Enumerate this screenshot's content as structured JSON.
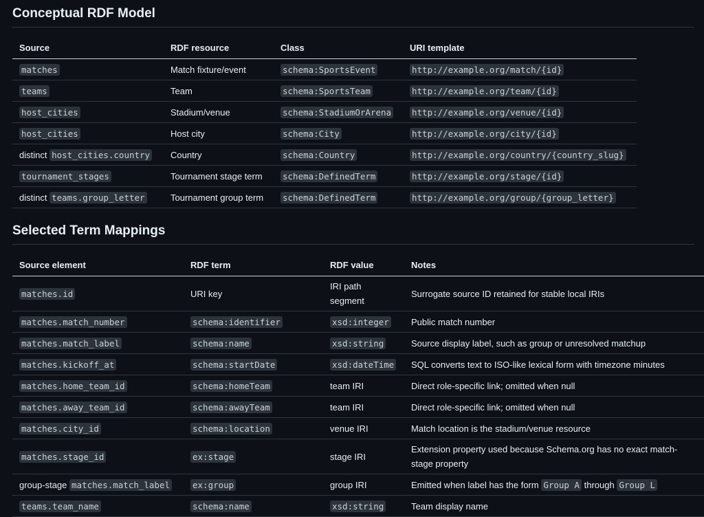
{
  "section1": {
    "title": "Conceptual RDF Model",
    "headers": [
      "Source",
      "RDF resource",
      "Class",
      "URI template"
    ],
    "rows": [
      {
        "source_prefix": "",
        "source_code": "matches",
        "resource": "Match fixture/event",
        "class": "schema:SportsEvent",
        "uri": "http://example.org/match/{id}"
      },
      {
        "source_prefix": "",
        "source_code": "teams",
        "resource": "Team",
        "class": "schema:SportsTeam",
        "uri": "http://example.org/team/{id}"
      },
      {
        "source_prefix": "",
        "source_code": "host_cities",
        "resource": "Stadium/venue",
        "class": "schema:StadiumOrArena",
        "uri": "http://example.org/venue/{id}"
      },
      {
        "source_prefix": "",
        "source_code": "host_cities",
        "resource": "Host city",
        "class": "schema:City",
        "uri": "http://example.org/city/{id}"
      },
      {
        "source_prefix": "distinct",
        "source_code": "host_cities.country",
        "resource": "Country",
        "class": "schema:Country",
        "uri": "http://example.org/country/{country_slug}"
      },
      {
        "source_prefix": "",
        "source_code": "tournament_stages",
        "resource": "Tournament stage term",
        "class": "schema:DefinedTerm",
        "uri": "http://example.org/stage/{id}"
      },
      {
        "source_prefix": "distinct",
        "source_code": "teams.group_letter",
        "resource": "Tournament group term",
        "class": "schema:DefinedTerm",
        "uri": "http://example.org/group/{group_letter}"
      }
    ]
  },
  "section2": {
    "title": "Selected Term Mappings",
    "headers": [
      "Source element",
      "RDF term",
      "RDF value",
      "Notes"
    ],
    "rows": [
      {
        "el_prefix": "",
        "el_code": "matches.id",
        "term": "URI key",
        "term_code": false,
        "value": "IRI path segment",
        "value_code": false,
        "note_parts": [
          "Surrogate source ID retained for stable local IRIs"
        ],
        "tall": true
      },
      {
        "el_prefix": "",
        "el_code": "matches.match_number",
        "term": "schema:identifier",
        "term_code": true,
        "value": "xsd:integer",
        "value_code": true,
        "note_parts": [
          "Public match number"
        ]
      },
      {
        "el_prefix": "",
        "el_code": "matches.match_label",
        "term": "schema:name",
        "term_code": true,
        "value": "xsd:string",
        "value_code": true,
        "note_parts": [
          "Source display label, such as group or unresolved matchup"
        ]
      },
      {
        "el_prefix": "",
        "el_code": "matches.kickoff_at",
        "term": "schema:startDate",
        "term_code": true,
        "value": "xsd:dateTime",
        "value_code": true,
        "note_parts": [
          "SQL converts text to ISO-like lexical form with timezone minutes"
        ]
      },
      {
        "el_prefix": "",
        "el_code": "matches.home_team_id",
        "term": "schema:homeTeam",
        "term_code": true,
        "value": "team IRI",
        "value_code": false,
        "note_parts": [
          "Direct role-specific link; omitted when null"
        ]
      },
      {
        "el_prefix": "",
        "el_code": "matches.away_team_id",
        "term": "schema:awayTeam",
        "term_code": true,
        "value": "team IRI",
        "value_code": false,
        "note_parts": [
          "Direct role-specific link; omitted when null"
        ]
      },
      {
        "el_prefix": "",
        "el_code": "matches.city_id",
        "term": "schema:location",
        "term_code": true,
        "value": "venue IRI",
        "value_code": false,
        "note_parts": [
          "Match location is the stadium/venue resource"
        ]
      },
      {
        "el_prefix": "",
        "el_code": "matches.stage_id",
        "term": "ex:stage",
        "term_code": true,
        "value": "stage IRI",
        "value_code": false,
        "note_parts": [
          "Extension property used because Schema.org has no exact match-stage property"
        ],
        "tall": true
      },
      {
        "el_prefix": "group-stage",
        "el_code": "matches.match_label",
        "term": "ex:group",
        "term_code": true,
        "value": "group IRI",
        "value_code": false,
        "note_parts": [
          "Emitted when label has the form ",
          "Group A",
          " through ",
          "Group L"
        ],
        "note_code_idx": [
          1,
          3
        ]
      },
      {
        "el_prefix": "",
        "el_code": "teams.team_name",
        "term": "schema:name",
        "term_code": true,
        "value": "xsd:string",
        "value_code": true,
        "note_parts": [
          "Team display name"
        ]
      }
    ]
  }
}
